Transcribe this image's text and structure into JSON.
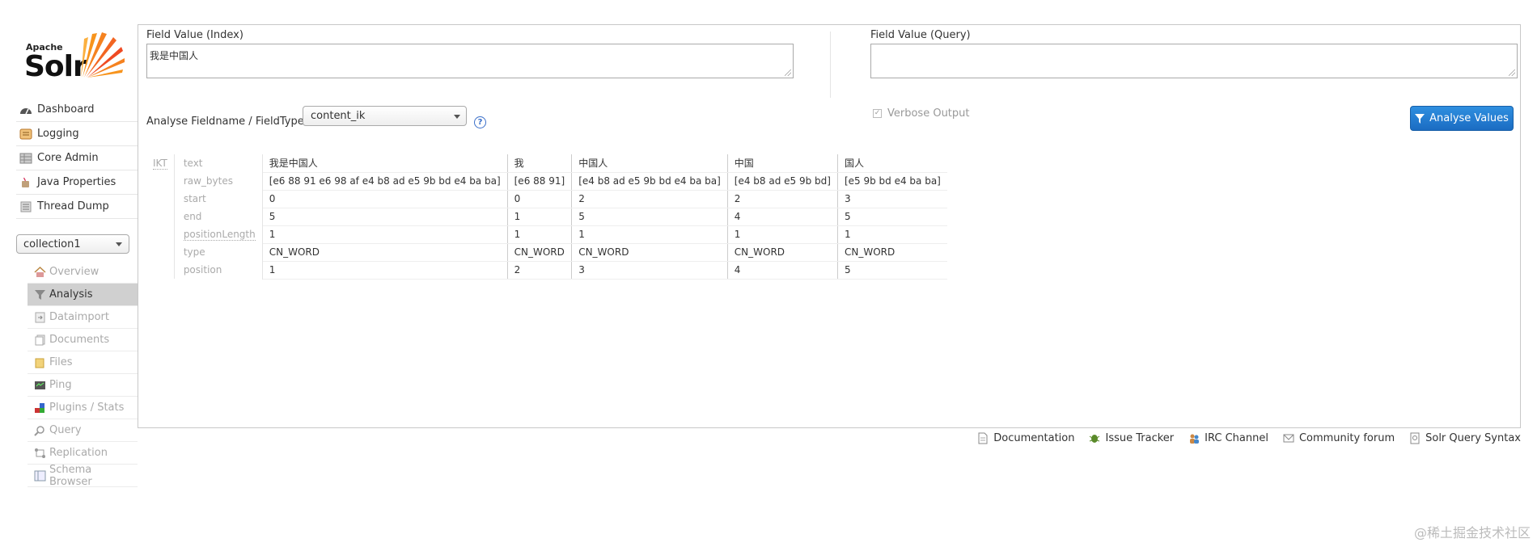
{
  "logo": {
    "apache": "Apache",
    "solr": "Solr"
  },
  "nav": {
    "main": [
      {
        "label": "Dashboard",
        "icon": "dashboard-icon"
      },
      {
        "label": "Logging",
        "icon": "logging-icon"
      },
      {
        "label": "Core Admin",
        "icon": "core-admin-icon"
      },
      {
        "label": "Java Properties",
        "icon": "java-icon"
      },
      {
        "label": "Thread Dump",
        "icon": "thread-dump-icon"
      }
    ],
    "core_selector": "collection1",
    "core": [
      {
        "label": "Overview",
        "icon": "home-icon"
      },
      {
        "label": "Analysis",
        "icon": "filter-icon",
        "active": true
      },
      {
        "label": "Dataimport",
        "icon": "dataimport-icon"
      },
      {
        "label": "Documents",
        "icon": "documents-icon"
      },
      {
        "label": "Files",
        "icon": "folder-icon"
      },
      {
        "label": "Ping",
        "icon": "ping-icon"
      },
      {
        "label": "Plugins / Stats",
        "icon": "plugins-icon"
      },
      {
        "label": "Query",
        "icon": "search-icon"
      },
      {
        "label": "Replication",
        "icon": "replication-icon"
      },
      {
        "label": "Schema Browser",
        "icon": "schema-icon"
      }
    ]
  },
  "analysis": {
    "index_label": "Field Value (Index)",
    "index_value": "我是中国人",
    "query_label": "Field Value (Query)",
    "query_value": "",
    "fieldtype_label": "Analyse Fieldname / FieldType:",
    "fieldtype_value": "content_ik",
    "help": "?",
    "verbose_label": "Verbose Output",
    "analyse_button": "Analyse Values",
    "tokenizer": "IKT",
    "keys": [
      "text",
      "raw_bytes",
      "start",
      "end",
      "positionLength",
      "type",
      "position"
    ],
    "tokens": [
      {
        "text": "我是中国人",
        "raw_bytes": "[e6 88 91 e6 98 af e4 b8 ad e5 9b bd e4 ba ba]",
        "start": "0",
        "end": "5",
        "positionLength": "1",
        "type": "CN_WORD",
        "position": "1"
      },
      {
        "text": "我",
        "raw_bytes": "[e6 88 91]",
        "start": "0",
        "end": "1",
        "positionLength": "1",
        "type": "CN_WORD",
        "position": "2"
      },
      {
        "text": "中国人",
        "raw_bytes": "[e4 b8 ad e5 9b bd e4 ba ba]",
        "start": "2",
        "end": "5",
        "positionLength": "1",
        "type": "CN_WORD",
        "position": "3"
      },
      {
        "text": "中国",
        "raw_bytes": "[e4 b8 ad e5 9b bd]",
        "start": "2",
        "end": "4",
        "positionLength": "1",
        "type": "CN_WORD",
        "position": "4"
      },
      {
        "text": "国人",
        "raw_bytes": "[e5 9b bd e4 ba ba]",
        "start": "3",
        "end": "5",
        "positionLength": "1",
        "type": "CN_WORD",
        "position": "5"
      }
    ]
  },
  "footer": [
    {
      "label": "Documentation",
      "icon": "document-icon"
    },
    {
      "label": "Issue Tracker",
      "icon": "bug-icon"
    },
    {
      "label": "IRC Channel",
      "icon": "irc-icon"
    },
    {
      "label": "Community forum",
      "icon": "mail-icon"
    },
    {
      "label": "Solr Query Syntax",
      "icon": "query-syntax-icon"
    }
  ],
  "watermark": "@稀土掘金技术社区",
  "colors": {
    "accent": "#1b6cc2",
    "logo_orange": "#f26522",
    "active_bg": "#d0d0d0"
  }
}
